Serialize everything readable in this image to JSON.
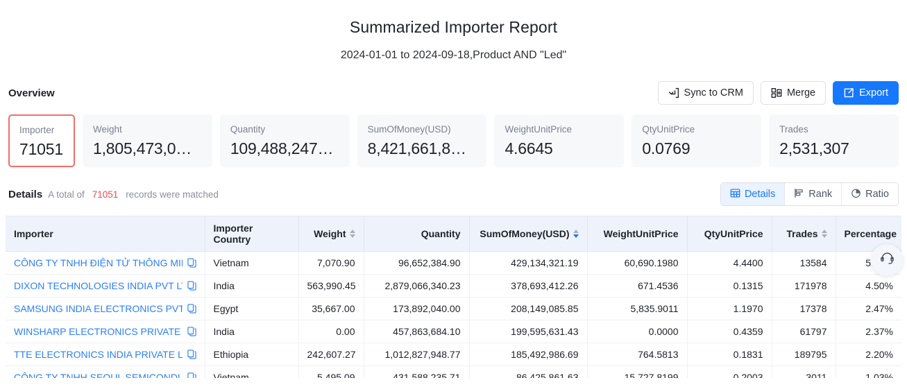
{
  "header": {
    "title": "Summarized Importer Report",
    "subtitle": "2024-01-01 to 2024-09-18,Product AND \"Led\""
  },
  "overview": {
    "label": "Overview",
    "toolbar": {
      "sync_label": "Sync to CRM",
      "merge_label": "Merge",
      "export_label": "Export",
      "primary_color": "#1677ff"
    },
    "cards": [
      {
        "label": "Importer",
        "value": "71051",
        "selected": true,
        "accent": "#f56c6c"
      },
      {
        "label": "Weight",
        "value": "1,805,473,0…",
        "selected": false
      },
      {
        "label": "Quantity",
        "value": "109,488,247…",
        "selected": false
      },
      {
        "label": "SumOfMoney(USD)",
        "value": "8,421,661,8…",
        "selected": false
      },
      {
        "label": "WeightUnitPrice",
        "value": "4.6645",
        "selected": false
      },
      {
        "label": "QtyUnitPrice",
        "value": "0.0769",
        "selected": false
      },
      {
        "label": "Trades",
        "value": "2,531,307",
        "selected": false
      }
    ]
  },
  "details": {
    "title": "Details",
    "note_prefix": "A total of",
    "count": "71051",
    "note_suffix": "records were matched",
    "count_color": "#f04a4a",
    "view_tabs": [
      {
        "label": "Details",
        "icon": "table-icon",
        "active": true
      },
      {
        "label": "Rank",
        "icon": "bar-chart-icon",
        "active": false
      },
      {
        "label": "Ratio",
        "icon": "pie-chart-icon",
        "active": false
      }
    ]
  },
  "table": {
    "columns": [
      {
        "label": "Importer",
        "align": "l",
        "sortable": false,
        "sort": "none"
      },
      {
        "label": "Importer Country",
        "align": "l",
        "sortable": false,
        "sort": "none"
      },
      {
        "label": "Weight",
        "align": "r",
        "sortable": true,
        "sort": "none"
      },
      {
        "label": "Quantity",
        "align": "r",
        "sortable": false,
        "sort": "none"
      },
      {
        "label": "SumOfMoney(USD)",
        "align": "r",
        "sortable": true,
        "sort": "desc"
      },
      {
        "label": "WeightUnitPrice",
        "align": "r",
        "sortable": false,
        "sort": "none"
      },
      {
        "label": "QtyUnitPrice",
        "align": "r",
        "sortable": false,
        "sort": "none"
      },
      {
        "label": "Trades",
        "align": "r",
        "sortable": true,
        "sort": "none"
      },
      {
        "label": "Percentage",
        "align": "r",
        "sortable": false,
        "sort": "none"
      }
    ],
    "rows": [
      {
        "importer": "CÔNG TY TNHH ĐIỆN TỬ THÔNG MIN",
        "country": "Vietnam",
        "weight": "7,070.90",
        "quantity": "96,652,384.90",
        "sum_of_money": "429,134,321.19",
        "weight_unit_price": "60,690.1980",
        "qty_unit_price": "4.4400",
        "trades": "13584",
        "percentage": "5.10%"
      },
      {
        "importer": "DIXON TECHNOLOGIES INDIA PVT LTI",
        "country": "India",
        "weight": "563,990.45",
        "quantity": "2,879,066,340.23",
        "sum_of_money": "378,693,412.26",
        "weight_unit_price": "671.4536",
        "qty_unit_price": "0.1315",
        "trades": "171978",
        "percentage": "4.50%"
      },
      {
        "importer": "SAMSUNG INDIA ELECTRONICS PVT I",
        "country": "Egypt",
        "weight": "35,667.00",
        "quantity": "173,892,040.00",
        "sum_of_money": "208,149,085.85",
        "weight_unit_price": "5,835.9011",
        "qty_unit_price": "1.1970",
        "trades": "17378",
        "percentage": "2.47%"
      },
      {
        "importer": "WINSHARP ELECTRONICS PRIVATE LI",
        "country": "India",
        "weight": "0.00",
        "quantity": "457,863,684.10",
        "sum_of_money": "199,595,631.43",
        "weight_unit_price": "0.0000",
        "qty_unit_price": "0.4359",
        "trades": "61797",
        "percentage": "2.37%"
      },
      {
        "importer": "TTE ELECTRONICS INDIA PRIVATE LIM",
        "country": "Ethiopia",
        "weight": "242,607.27",
        "quantity": "1,012,827,948.77",
        "sum_of_money": "185,492,986.69",
        "weight_unit_price": "764.5813",
        "qty_unit_price": "0.1831",
        "trades": "189795",
        "percentage": "2.20%"
      },
      {
        "importer": "CÔNG TY TNHH SEOUL SEMICONDUC",
        "country": "Vietnam",
        "weight": "5,495.09",
        "quantity": "431,588,235.71",
        "sum_of_money": "86,425,861.63",
        "weight_unit_price": "15,727.8199",
        "qty_unit_price": "0.2003",
        "trades": "3011",
        "percentage": "1.03%"
      }
    ]
  },
  "support": {
    "icon": "headset-icon"
  }
}
